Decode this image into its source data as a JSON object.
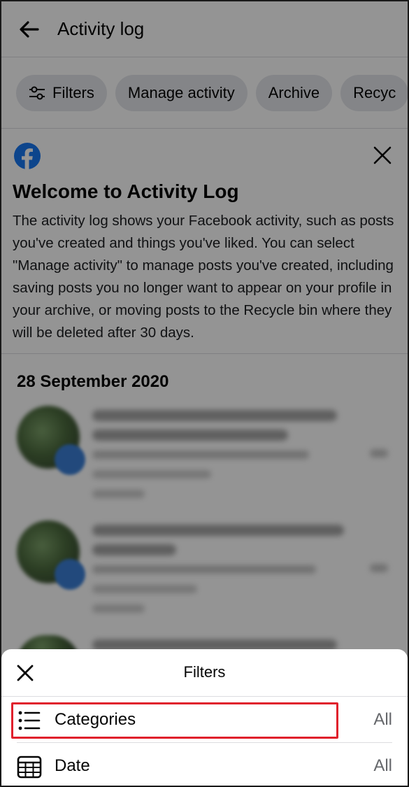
{
  "header": {
    "title": "Activity log",
    "back_icon": "arrow-left-icon"
  },
  "chips": [
    {
      "label": "Filters",
      "icon": "sliders-icon"
    },
    {
      "label": "Manage activity"
    },
    {
      "label": "Archive"
    },
    {
      "label": "Recyc"
    }
  ],
  "welcome": {
    "logo": "facebook-logo-icon",
    "title": "Welcome to Activity Log",
    "body": "The activity log shows your Facebook activity, such as posts you've created and things you've liked. You can select \"Manage activity\" to manage posts you've created, including saving posts you no longer want to appear on your profile in your archive, or moving posts to the Recycle bin where they will be deleted after 30 days."
  },
  "date_heading": "28 September 2020",
  "sheet": {
    "title": "Filters",
    "close_icon": "close-icon",
    "rows": [
      {
        "label": "Categories",
        "value": "All",
        "icon": "list-icon",
        "highlighted": true
      },
      {
        "label": "Date",
        "value": "All",
        "icon": "calendar-icon"
      }
    ]
  },
  "colors": {
    "chip_bg": "#e4e6eb",
    "facebook_blue": "#1877f2",
    "highlight_red": "#e0202c",
    "secondary_text": "#65676b"
  }
}
